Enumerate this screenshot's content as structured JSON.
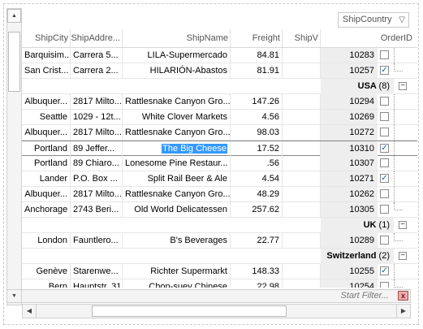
{
  "groupby": {
    "label": "ShipCountry"
  },
  "columns": {
    "ship_city": "ShipCity",
    "ship_address": "ShipAddre...",
    "ship_name": "ShipName",
    "freight": "Freight",
    "ship_via": "ShipV",
    "order_id": "OrderID"
  },
  "rows": [
    {
      "type": "data",
      "city": "Barquisim...",
      "addr": "Carrera 5...",
      "name": "LILA-Supermercado",
      "freight": "84.81",
      "order": "10283",
      "checked": false
    },
    {
      "type": "data",
      "city": "San Crist...",
      "addr": "Carrera 2...",
      "name": "HILARIÓN-Abastos",
      "freight": "81.91",
      "order": "10257",
      "checked": true
    },
    {
      "type": "group",
      "country": "USA",
      "count": "(8)"
    },
    {
      "type": "data",
      "city": "Albuquer...",
      "addr": "2817 Milto...",
      "name": "Rattlesnake Canyon Gro...",
      "freight": "147.26",
      "order": "10294",
      "checked": false
    },
    {
      "type": "data",
      "city": "Seattle",
      "addr": "1029 - 12t...",
      "name": "White Clover Markets",
      "freight": "4.56",
      "order": "10269",
      "checked": false
    },
    {
      "type": "data",
      "city": "Albuquer...",
      "addr": "2817 Milto...",
      "name": "Rattlesnake Canyon Gro...",
      "freight": "98.03",
      "order": "10272",
      "checked": false
    },
    {
      "type": "data",
      "city": "Portland",
      "addr": "89 Jeffer...",
      "name": "The Big Cheese",
      "freight": "17.52",
      "order": "10310",
      "checked": true,
      "selected": true
    },
    {
      "type": "data",
      "city": "Portland",
      "addr": "89 Chiaro...",
      "name": "Lonesome Pine Restaur...",
      "freight": ".56",
      "order": "10307",
      "checked": false
    },
    {
      "type": "data",
      "city": "Lander",
      "addr": "P.O. Box ...",
      "name": "Split Rail Beer & Ale",
      "freight": "4.54",
      "order": "10271",
      "checked": true
    },
    {
      "type": "data",
      "city": "Albuquer...",
      "addr": "2817 Milto...",
      "name": "Rattlesnake Canyon Gro...",
      "freight": "48.29",
      "order": "10262",
      "checked": false
    },
    {
      "type": "data",
      "city": "Anchorage",
      "addr": "2743 Beri...",
      "name": "Old World Delicatessen",
      "freight": "257.62",
      "order": "10305",
      "checked": false
    },
    {
      "type": "group",
      "country": "UK",
      "count": "(1)"
    },
    {
      "type": "data",
      "city": "London",
      "addr": "Fauntlero...",
      "name": "B's Beverages",
      "freight": "22.77",
      "order": "10289",
      "checked": false
    },
    {
      "type": "group",
      "country": "Switzerland",
      "count": "(2)"
    },
    {
      "type": "data",
      "city": "Genève",
      "addr": "Starenwe...",
      "name": "Richter Supermarkt",
      "freight": "148.33",
      "order": "10255",
      "checked": true
    },
    {
      "type": "data",
      "city": "Bern",
      "addr": "Hauptstr. 31",
      "name": "Chop-suey Chinese",
      "freight": "22.98",
      "order": "10254",
      "checked": false
    }
  ],
  "filter": {
    "placeholder": "Start Filter..."
  },
  "icons": {
    "check": "✓",
    "minus": "−",
    "close": "x"
  }
}
